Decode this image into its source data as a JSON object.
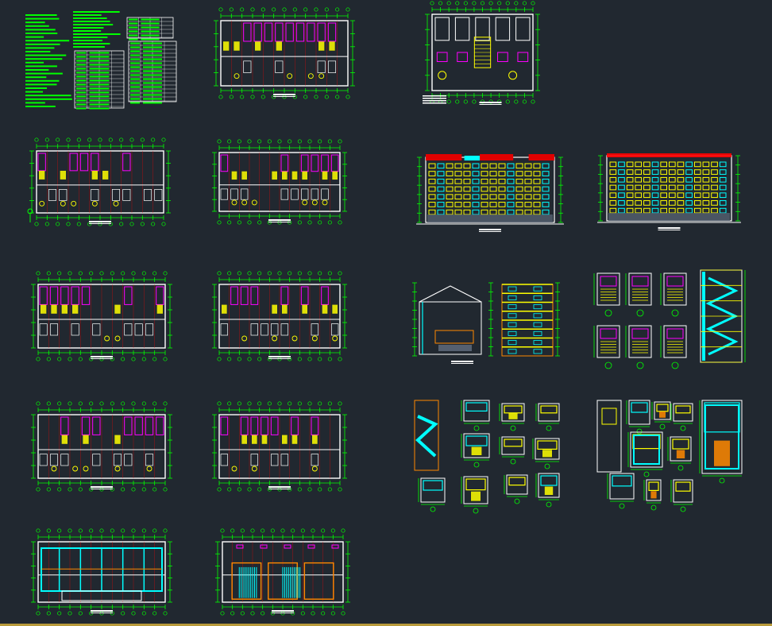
{
  "app": {
    "background": "#212830",
    "status_line_color": "#b89a3a"
  },
  "colors": {
    "wall": "#ffffff",
    "dimension": "#00ff00",
    "axis": "#ff0000",
    "furniture": "#ff00ff",
    "fixture": "#ffff00",
    "glass": "#00ffff",
    "accent": "#ff8800",
    "title_bar": "#ffffff"
  },
  "sheets": [
    {
      "id": "design-notes",
      "kind": "notes"
    },
    {
      "id": "roof-plan",
      "kind": "floor-plan",
      "variant": "roof"
    },
    {
      "id": "stair-unit-plan",
      "kind": "unit-plan"
    },
    {
      "id": "floor-plan-1",
      "kind": "floor-plan",
      "variant": "ground"
    },
    {
      "id": "floor-plan-2",
      "kind": "floor-plan",
      "variant": "typical"
    },
    {
      "id": "south-elevation",
      "kind": "elevation",
      "variant": "red-roof"
    },
    {
      "id": "north-elevation",
      "kind": "elevation",
      "variant": "flat"
    },
    {
      "id": "floor-plan-3",
      "kind": "floor-plan",
      "variant": "typical"
    },
    {
      "id": "floor-plan-4",
      "kind": "floor-plan",
      "variant": "typical"
    },
    {
      "id": "side-sections",
      "kind": "section"
    },
    {
      "id": "stair-details",
      "kind": "stair-detail"
    },
    {
      "id": "floor-plan-5",
      "kind": "floor-plan",
      "variant": "typical"
    },
    {
      "id": "floor-plan-6",
      "kind": "floor-plan",
      "variant": "typical"
    },
    {
      "id": "wall-details-a",
      "kind": "detail"
    },
    {
      "id": "wall-details-b",
      "kind": "detail"
    },
    {
      "id": "foundation-plan",
      "kind": "floor-plan",
      "variant": "foundation"
    },
    {
      "id": "garage-plan",
      "kind": "floor-plan",
      "variant": "garage"
    }
  ]
}
